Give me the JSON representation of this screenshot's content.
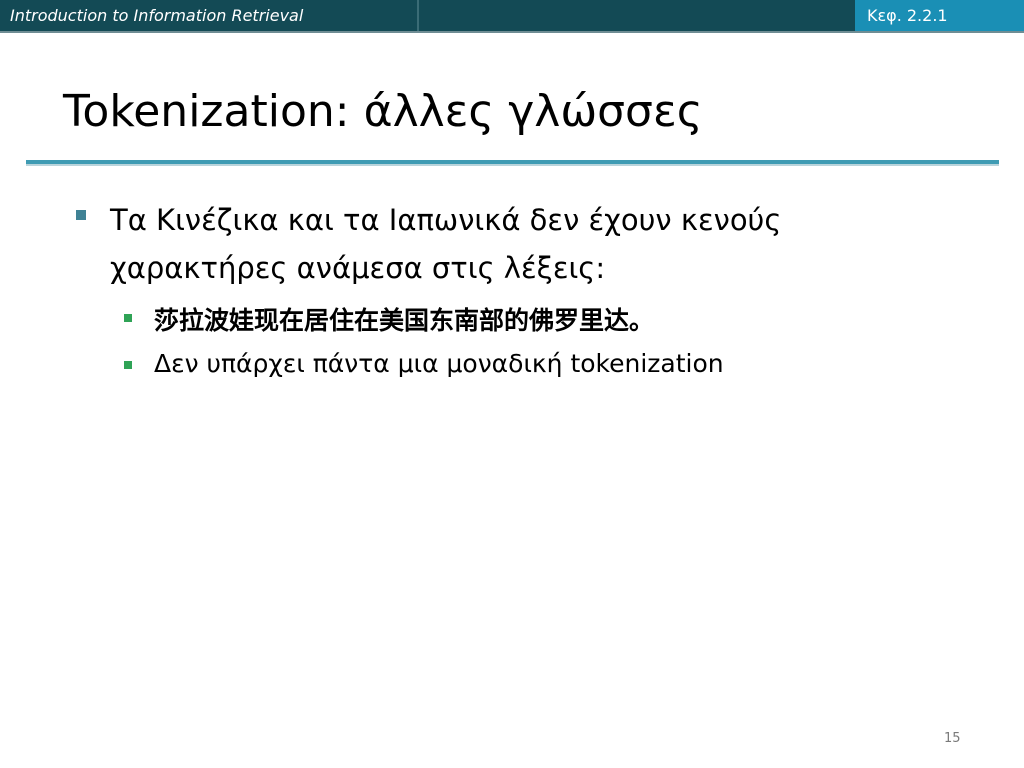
{
  "header": {
    "course_title": "Introduction to Information Retrieval",
    "section_ref": "Κεφ. 2.2.1",
    "colors": {
      "bar": "#134a55",
      "section_box": "#1a8fb5"
    }
  },
  "slide": {
    "title": "Tokenization: άλλες γλώσσες",
    "bullets": [
      {
        "text": "Τα Κινέζικα και τα Ιαπωνικά δεν έχουν κενούς χαρακτήρες ανάμεσα στις λέξεις:",
        "sub_bullets": [
          {
            "text": "莎拉波娃现在居住在美国东南部的佛罗里达。"
          },
          {
            "text": "Δεν υπάρχει πάντα μια μοναδική tokenization"
          }
        ]
      }
    ],
    "page_number": "15"
  }
}
